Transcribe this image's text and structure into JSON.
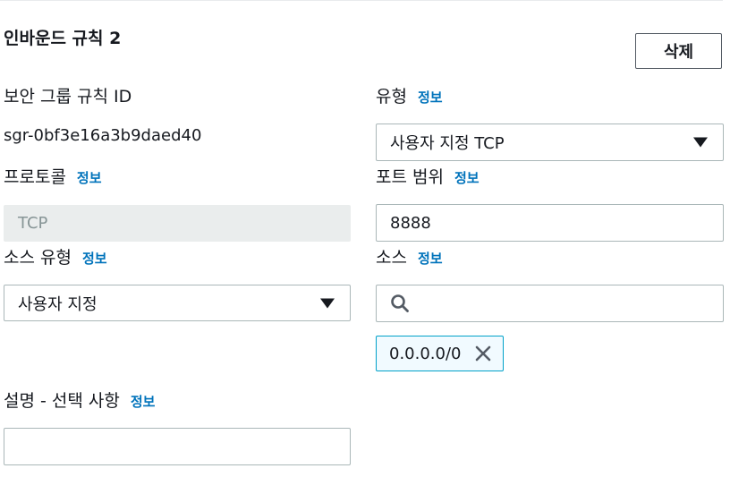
{
  "rule": {
    "title": "인바운드 규칙 2",
    "delete_label": "삭제"
  },
  "info_link": "정보",
  "fields": {
    "rule_id": {
      "label": "보안 그룹 규칙 ID",
      "value": "sgr-0bf3e16a3b9daed40"
    },
    "type": {
      "label": "유형",
      "value": "사용자 지정 TCP"
    },
    "protocol": {
      "label": "프로토콜",
      "value": "TCP"
    },
    "port_range": {
      "label": "포트 범위",
      "value": "8888"
    },
    "source_type": {
      "label": "소스 유형",
      "value": "사용자 지정"
    },
    "source": {
      "label": "소스",
      "search_value": "",
      "token": "0.0.0.0/0"
    },
    "description": {
      "label": "설명 - 선택 사항",
      "value": ""
    }
  },
  "icons": {
    "dropdown": "caret-down-icon",
    "search": "search-icon",
    "remove": "close-icon"
  },
  "colors": {
    "link": "#0073bb",
    "token_border": "#00a1c9",
    "token_bg": "#f1faff",
    "disabled_bg": "#eaeded"
  }
}
